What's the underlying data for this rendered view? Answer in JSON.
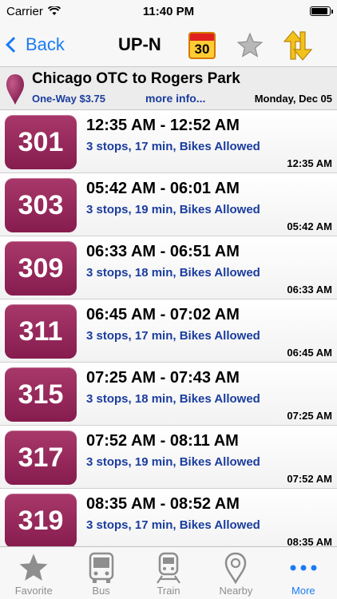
{
  "status": {
    "carrier": "Carrier",
    "time": "11:40 PM",
    "battery_level": 0.9
  },
  "nav": {
    "back_label": "Back",
    "title": "UP-N",
    "calendar_day": "30"
  },
  "route": {
    "title": "Chicago OTC to Rogers Park",
    "fare": "One-Way $3.75",
    "more_info": "more info...",
    "date": "Monday, Dec 05"
  },
  "trips": [
    {
      "number": "301",
      "times": "12:35 AM - 12:52 AM",
      "info": "3 stops, 17 min, Bikes Allowed",
      "depart": "12:35 AM"
    },
    {
      "number": "303",
      "times": "05:42 AM - 06:01 AM",
      "info": "3 stops, 19 min, Bikes Allowed",
      "depart": "05:42 AM"
    },
    {
      "number": "309",
      "times": "06:33 AM - 06:51 AM",
      "info": "3 stops, 18 min, Bikes Allowed",
      "depart": "06:33 AM"
    },
    {
      "number": "311",
      "times": "06:45 AM - 07:02 AM",
      "info": "3 stops, 17 min, Bikes Allowed",
      "depart": "06:45 AM"
    },
    {
      "number": "315",
      "times": "07:25 AM - 07:43 AM",
      "info": "3 stops, 18 min, Bikes Allowed",
      "depart": "07:25 AM"
    },
    {
      "number": "317",
      "times": "07:52 AM - 08:11 AM",
      "info": "3 stops, 19 min, Bikes Allowed",
      "depart": "07:52 AM"
    },
    {
      "number": "319",
      "times": "08:35 AM - 08:52 AM",
      "info": "3 stops, 17 min, Bikes Allowed",
      "depart": "08:35 AM"
    }
  ],
  "tabs": [
    {
      "label": "Favorite",
      "icon": "star-icon"
    },
    {
      "label": "Bus",
      "icon": "bus-icon"
    },
    {
      "label": "Train",
      "icon": "train-icon"
    },
    {
      "label": "Nearby",
      "icon": "location-pin-icon"
    },
    {
      "label": "More",
      "icon": "more-dots-icon",
      "active": true
    }
  ],
  "colors": {
    "accent": "#1a7cf5",
    "badge": "#951f58",
    "link": "#1a3c9e"
  }
}
